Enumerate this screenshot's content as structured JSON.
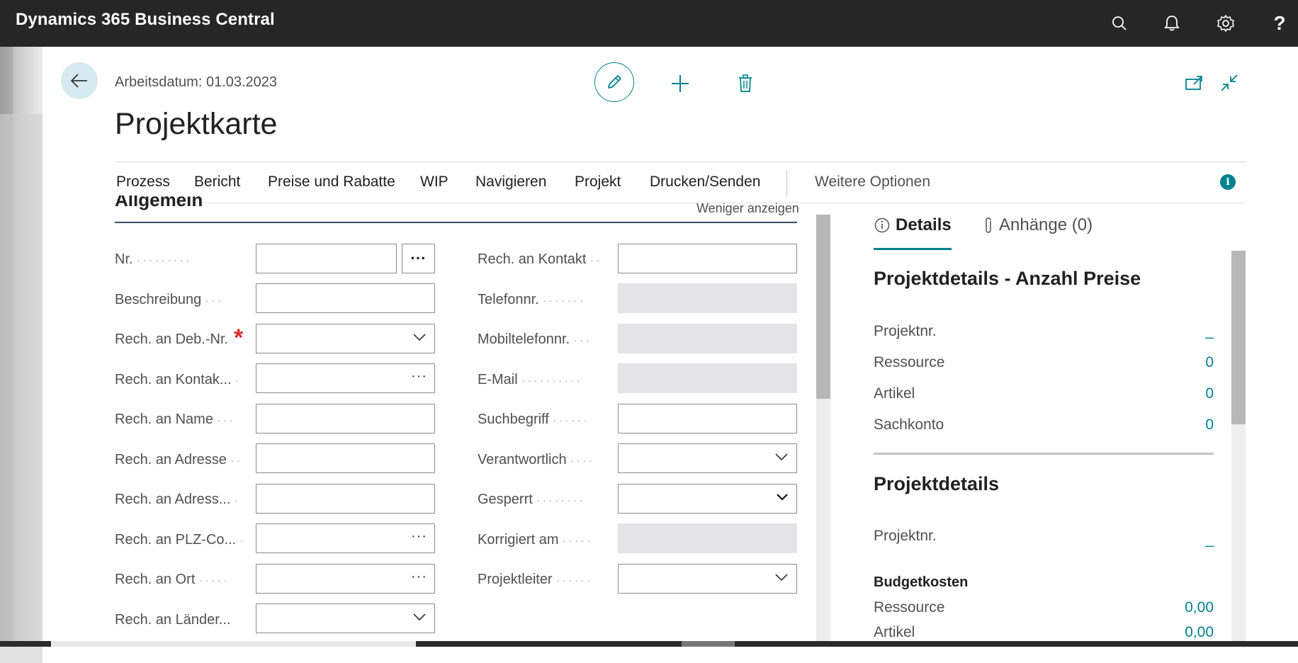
{
  "app": {
    "title": "Dynamics 365 Business Central"
  },
  "topbar": {
    "icons": [
      "search-icon",
      "bell-icon",
      "gear-icon",
      "help-icon"
    ],
    "help_glyph": "?"
  },
  "header": {
    "work_date": "Arbeitsdatum: 01.03.2023",
    "page_title": "Projektkarte"
  },
  "menu": {
    "items": [
      "Prozess",
      "Bericht",
      "Preise und Rabatte",
      "WIP",
      "Navigieren",
      "Projekt",
      "Drucken/Senden"
    ],
    "more": "Weitere Optionen",
    "info": "i"
  },
  "section": {
    "title": "Allgemein",
    "toggle": "Weniger anzeigen"
  },
  "fields_left": [
    {
      "label": "Nr.",
      "value": "",
      "type": "text-assist"
    },
    {
      "label": "Beschreibung",
      "value": "",
      "type": "text"
    },
    {
      "label": "Rech. an Deb.-Nr.",
      "value": "",
      "type": "select",
      "required": true
    },
    {
      "label": "Rech. an Kontak...",
      "value": "",
      "type": "lookup"
    },
    {
      "label": "Rech. an Name",
      "value": "",
      "type": "text"
    },
    {
      "label": "Rech. an Adresse",
      "value": "",
      "type": "text"
    },
    {
      "label": "Rech. an Adress...",
      "value": "",
      "type": "text"
    },
    {
      "label": "Rech. an PLZ-Co...",
      "value": "",
      "type": "lookup"
    },
    {
      "label": "Rech. an Ort",
      "value": "",
      "type": "lookup"
    },
    {
      "label": "Rech. an Länder...",
      "value": "",
      "type": "select"
    }
  ],
  "fields_right": [
    {
      "label": "Rech. an Kontakt",
      "value": "",
      "type": "text"
    },
    {
      "label": "Telefonnr.",
      "value": "",
      "type": "disabled"
    },
    {
      "label": "Mobiltelefonnr.",
      "value": "",
      "type": "disabled"
    },
    {
      "label": "E-Mail",
      "value": "",
      "type": "disabled"
    },
    {
      "label": "Suchbegriff",
      "value": "",
      "type": "text"
    },
    {
      "label": "Verantwortlich",
      "value": "",
      "type": "select"
    },
    {
      "label": "Gesperrt",
      "value": "",
      "type": "select"
    },
    {
      "label": "Korrigiert am",
      "value": "",
      "type": "disabled"
    },
    {
      "label": "Projektleiter",
      "value": "",
      "type": "select"
    }
  ],
  "assist_glyph": "···",
  "factbox": {
    "tabs": [
      {
        "label": "Details",
        "icon": "info-circle-icon"
      },
      {
        "label": "Anhänge (0)",
        "icon": "paperclip-icon"
      }
    ],
    "price_count": {
      "title": "Projektdetails - Anzahl Preise",
      "rows": [
        {
          "label": "Projektnr.",
          "value": "_"
        },
        {
          "label": "Ressource",
          "value": "0"
        },
        {
          "label": "Artikel",
          "value": "0"
        },
        {
          "label": "Sachkonto",
          "value": "0"
        }
      ]
    },
    "details": {
      "title": "Projektdetails",
      "rows": [
        {
          "label": "Projektnr.",
          "value": "_"
        }
      ],
      "budget_title": "Budgetkosten",
      "budget_rows": [
        {
          "label": "Ressource",
          "value": "0,00"
        },
        {
          "label": "Artikel",
          "value": "0,00"
        }
      ]
    }
  },
  "colors": {
    "accent": "#00838f",
    "topbar": "#262626",
    "required": "#e02a2a"
  }
}
